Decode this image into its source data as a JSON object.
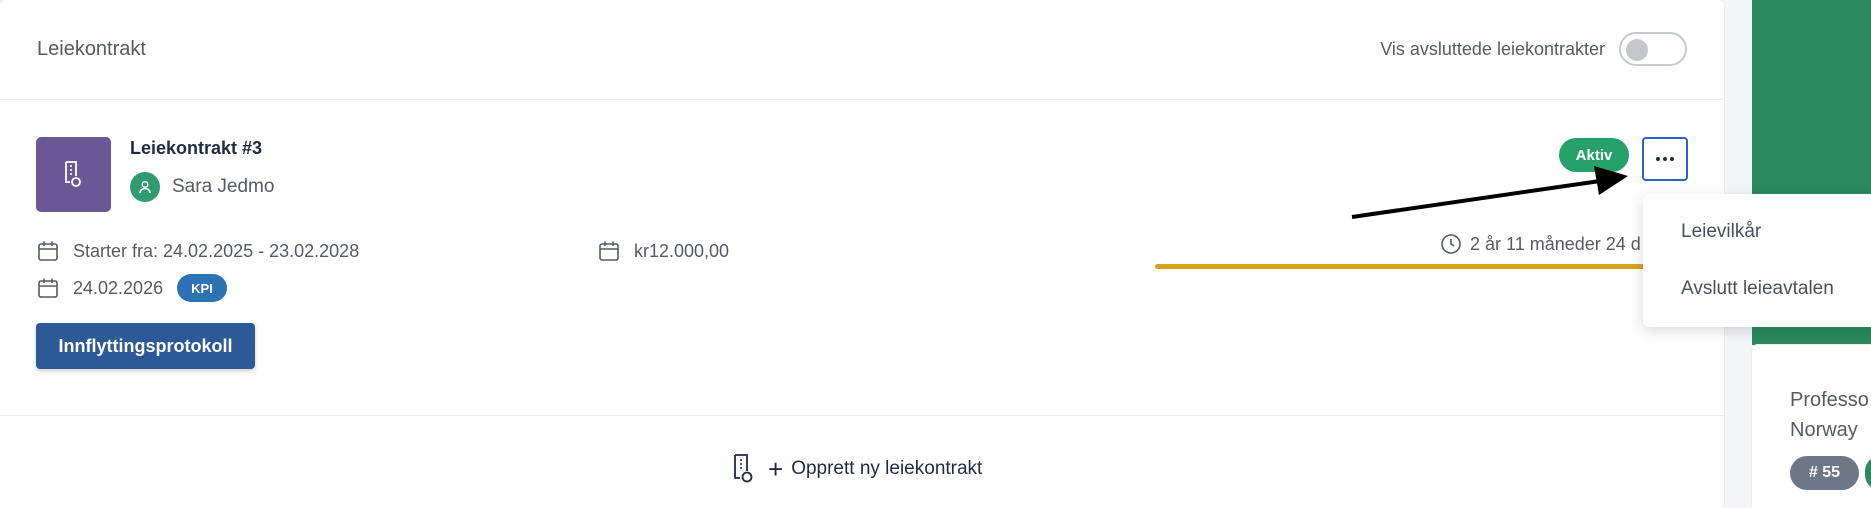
{
  "header": {
    "title": "Leiekontrakt",
    "toggle_label": "Vis avsluttede leiekontrakter",
    "toggle_on": false
  },
  "contract": {
    "name": "Leiekontrakt #3",
    "tenant": "Sara Jedmo",
    "status": "Aktiv",
    "period": "Starter fra: 24.02.2025 - 23.02.2028",
    "rent": "kr12.000,00",
    "adjust_date": "24.02.2026",
    "kpi_badge": "KPI",
    "remaining": "2 år 11 måneder 24 d",
    "protocol_button": "Innflyttingsprotokoll"
  },
  "create_link": "Opprett ny leiekontrakt",
  "menu": {
    "items": [
      "Leievilkår",
      "Avslutt leieavtalen"
    ]
  },
  "side": {
    "line1": "Professo",
    "line2": "Norway",
    "badge": "# 55"
  },
  "colors": {
    "status": "#26a169",
    "progress": "#d9a21b",
    "primary_button": "#2b5a96",
    "contract_icon_bg": "#6b5996",
    "side_green": "#2b8a5d"
  }
}
